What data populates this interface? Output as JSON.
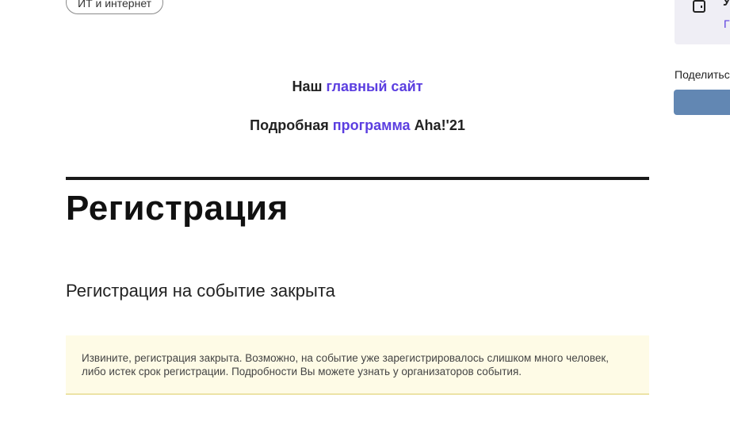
{
  "tag": {
    "label": "ИТ и интернет"
  },
  "links": {
    "main_site_prefix": "Наш",
    "main_site_link": "главный сайт",
    "program_prefix": "Подробная",
    "program_link": "программа",
    "program_suffix": "Aha!'21"
  },
  "registration": {
    "title": "Регистрация",
    "subtitle": "Регистрация на событие закрыта",
    "notice": "Извините, регистрация закрыта. Возможно, на событие уже зарегистрировалось слишком много человек, либо истек срок регистрации. Подробности Вы можете узнать у организаторов события."
  },
  "sidebar": {
    "card_letter": "У",
    "card_link_letter": "Г",
    "card_icon": "phone-icon",
    "share_label": "Поделиться"
  },
  "colors": {
    "accent": "#5b3ee0",
    "share_button": "#6287b3",
    "notice_bg": "#fefbe6"
  }
}
